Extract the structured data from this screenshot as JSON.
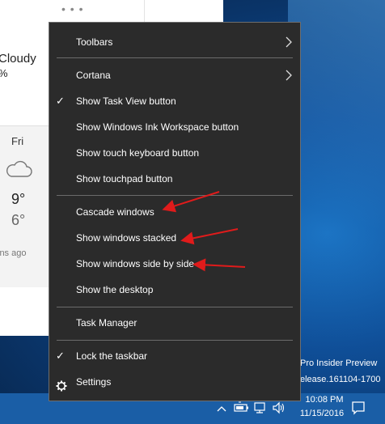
{
  "weather": {
    "condition": "Cloudy",
    "percent": "%",
    "day": "Fri",
    "high": "9°",
    "low": "6°",
    "updated": "ins ago",
    "more_glyph": "• • •"
  },
  "menu": {
    "items": [
      {
        "label": "Toolbars",
        "submenu": true,
        "checked": false
      },
      {
        "label": "Cortana",
        "submenu": true,
        "checked": false
      },
      {
        "label": "Show Task View button",
        "submenu": false,
        "checked": true
      },
      {
        "label": "Show Windows Ink Workspace button",
        "submenu": false,
        "checked": false
      },
      {
        "label": "Show touch keyboard button",
        "submenu": false,
        "checked": false
      },
      {
        "label": "Show touchpad button",
        "submenu": false,
        "checked": false
      },
      {
        "label": "Cascade windows",
        "submenu": false,
        "checked": false
      },
      {
        "label": "Show windows stacked",
        "submenu": false,
        "checked": false
      },
      {
        "label": "Show windows side by side",
        "submenu": false,
        "checked": false
      },
      {
        "label": "Show the desktop",
        "submenu": false,
        "checked": false
      },
      {
        "label": "Task Manager",
        "submenu": false,
        "checked": false
      },
      {
        "label": "Lock the taskbar",
        "submenu": false,
        "checked": true
      },
      {
        "label": "Settings",
        "submenu": false,
        "checked": false,
        "icon": "gear-icon"
      }
    ],
    "check_glyph": "✓",
    "arrow_glyph": "〉"
  },
  "desktop": {
    "watermark_line1": "Pro Insider Preview",
    "watermark_line2": "elease.161104-1700"
  },
  "taskbar": {
    "time": "10:08 PM",
    "date": "11/15/2016",
    "tray_icons": [
      "chevron-up-icon",
      "battery-icon",
      "network-icon",
      "volume-icon",
      "notification-icon"
    ]
  },
  "colors": {
    "menu_bg": "#2b2b2b",
    "menu_border": "#6e6e6e",
    "annotation_arrow": "#e01b1b",
    "taskbar": "#1a5ea6"
  }
}
